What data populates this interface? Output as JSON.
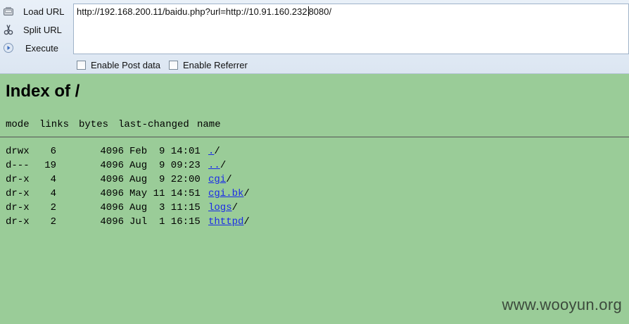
{
  "toolbar": {
    "load_url_label": "Load URL",
    "split_url_label": "Split URL",
    "execute_label": "Execute",
    "url_before_caret": "http://192.168.200.11/baidu.php?url=http://10.91.160.232",
    "url_after_caret": "8080/",
    "enable_post_label": "Enable Post data",
    "enable_referrer_label": "Enable Referrer",
    "enable_post_checked": false,
    "enable_referrer_checked": false
  },
  "listing": {
    "title": "Index of /",
    "headers": {
      "mode": "mode",
      "links": "links",
      "bytes": "bytes",
      "last_changed": "last-changed",
      "name": "name"
    },
    "rows": [
      {
        "mode": "drwx",
        "links": "6",
        "bytes": "4096",
        "date": "Feb  9 14:01",
        "name": ".",
        "suffix": "/"
      },
      {
        "mode": "d---",
        "links": "19",
        "bytes": "4096",
        "date": "Aug  9 09:23",
        "name": "..",
        "suffix": "/"
      },
      {
        "mode": "dr-x",
        "links": "4",
        "bytes": "4096",
        "date": "Aug  9 22:00",
        "name": "cgi",
        "suffix": "/"
      },
      {
        "mode": "dr-x",
        "links": "4",
        "bytes": "4096",
        "date": "May 11 14:51",
        "name": "cgi.bk",
        "suffix": "/"
      },
      {
        "mode": "dr-x",
        "links": "2",
        "bytes": "4096",
        "date": "Aug  3 11:15",
        "name": "logs",
        "suffix": "/"
      },
      {
        "mode": "dr-x",
        "links": "2",
        "bytes": "4096",
        "date": "Jul  1 16:15",
        "name": "thttpd",
        "suffix": "/"
      }
    ]
  },
  "watermark": "www.wooyun.org",
  "colors": {
    "page_background": "#9acc98",
    "link": "#1a2ae8",
    "toolbar_background": "#e3ebf5"
  },
  "icons": {
    "load_url": "load-url-icon",
    "split_url": "split-url-icon",
    "execute": "execute-icon"
  }
}
